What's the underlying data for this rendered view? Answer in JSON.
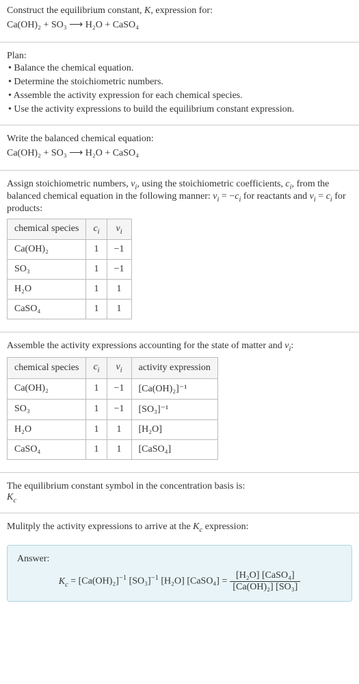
{
  "header": {
    "line1": "Construct the equilibrium constant, K, expression for:",
    "equation": "Ca(OH)₂ + SO₃  ⟶  H₂O + CaSO₄"
  },
  "plan": {
    "title": "Plan:",
    "items": [
      "• Balance the chemical equation.",
      "• Determine the stoichiometric numbers.",
      "• Assemble the activity expression for each chemical species.",
      "• Use the activity expressions to build the equilibrium constant expression."
    ]
  },
  "balanced": {
    "title": "Write the balanced chemical equation:",
    "equation": "Ca(OH)₂ + SO₃  ⟶  H₂O + CaSO₄"
  },
  "assign": {
    "text": "Assign stoichiometric numbers, νᵢ, using the stoichiometric coefficients, cᵢ, from the balanced chemical equation in the following manner: νᵢ = −cᵢ for reactants and νᵢ = cᵢ for products:",
    "headers": [
      "chemical species",
      "cᵢ",
      "νᵢ"
    ],
    "rows": [
      {
        "species": "Ca(OH)₂",
        "c": "1",
        "v": "−1"
      },
      {
        "species": "SO₃",
        "c": "1",
        "v": "−1"
      },
      {
        "species": "H₂O",
        "c": "1",
        "v": "1"
      },
      {
        "species": "CaSO₄",
        "c": "1",
        "v": "1"
      }
    ]
  },
  "activity": {
    "text": "Assemble the activity expressions accounting for the state of matter and νᵢ:",
    "headers": [
      "chemical species",
      "cᵢ",
      "νᵢ",
      "activity expression"
    ],
    "rows": [
      {
        "species": "Ca(OH)₂",
        "c": "1",
        "v": "−1",
        "expr": "[Ca(OH)₂]⁻¹"
      },
      {
        "species": "SO₃",
        "c": "1",
        "v": "−1",
        "expr": "[SO₃]⁻¹"
      },
      {
        "species": "H₂O",
        "c": "1",
        "v": "1",
        "expr": "[H₂O]"
      },
      {
        "species": "CaSO₄",
        "c": "1",
        "v": "1",
        "expr": "[CaSO₄]"
      }
    ]
  },
  "symbol": {
    "text": "The equilibrium constant symbol in the concentration basis is:",
    "kc": "K𝒸"
  },
  "multiply": {
    "text": "Mulitply the activity expressions to arrive at the K𝒸 expression:"
  },
  "answer": {
    "label": "Answer:",
    "lhs": "K𝒸 = [Ca(OH)₂]⁻¹ [SO₃]⁻¹ [H₂O] [CaSO₄] =",
    "num": "[H₂O] [CaSO₄]",
    "den": "[Ca(OH)₂] [SO₃]"
  }
}
